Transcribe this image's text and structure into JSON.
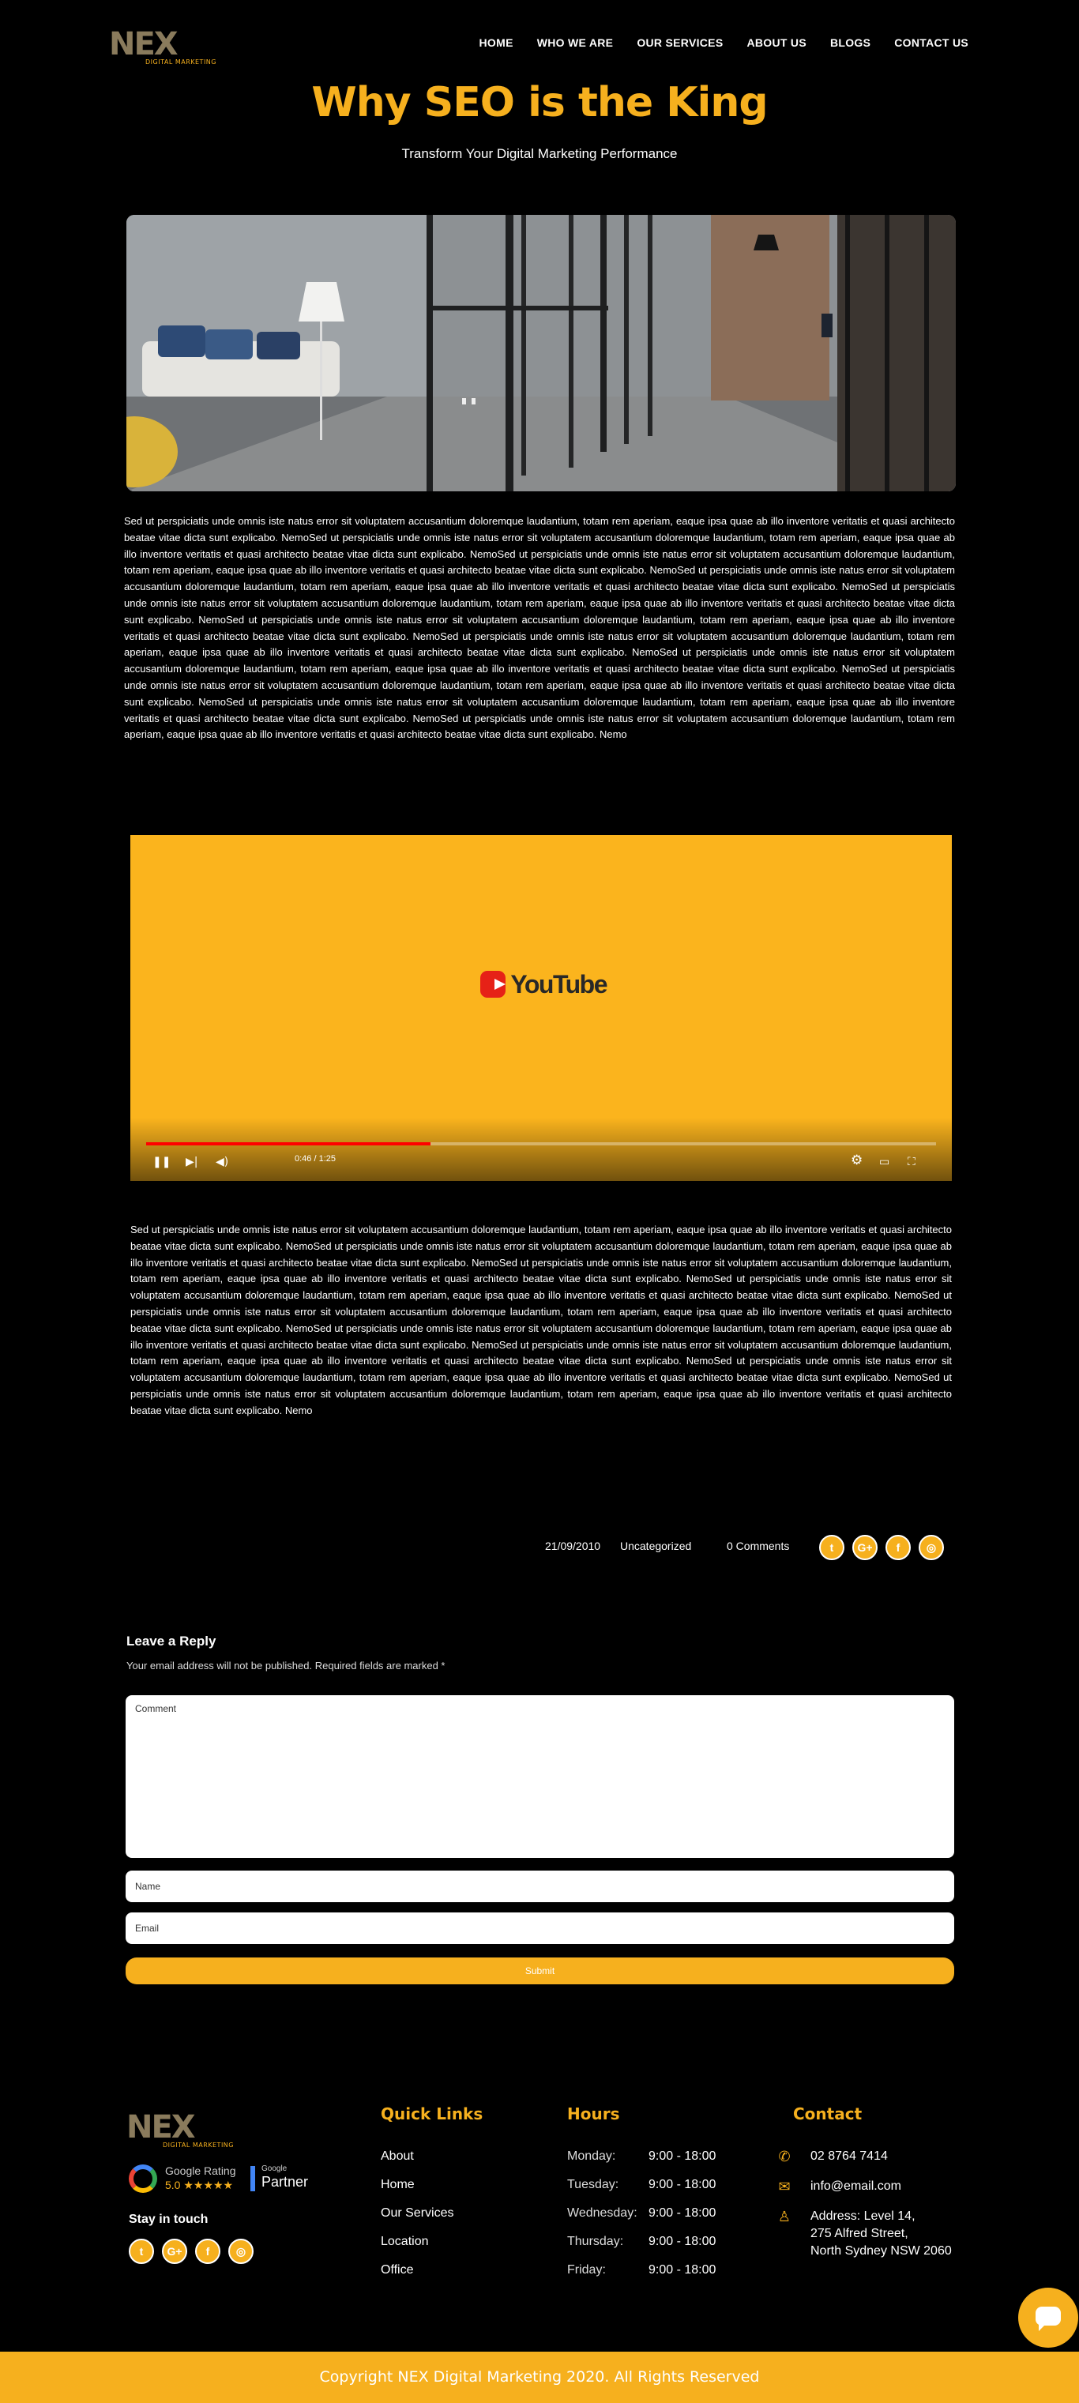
{
  "header": {
    "logo_text": "NEX",
    "logo_tagline": "DIGITAL MARKETING",
    "nav": [
      "HOME",
      "WHO WE ARE",
      "OUR SERVICES",
      "ABOUT US",
      "BLOGS",
      "CONTACT US"
    ]
  },
  "article": {
    "title": "Why SEO is the King",
    "subtitle": "Transform Your Digital Marketing Performance",
    "paragraph_1": "Sed ut perspiciatis unde omnis iste natus error sit voluptatem accusantium doloremque laudantium, totam rem aperiam, eaque ipsa quae ab illo inventore veritatis et quasi architecto beatae vitae dicta sunt explicabo. NemoSed ut perspiciatis unde omnis iste natus error sit voluptatem accusantium doloremque laudantium, totam rem aperiam, eaque ipsa quae ab illo inventore veritatis et quasi architecto beatae vitae dicta sunt explicabo. NemoSed ut perspiciatis unde omnis iste natus error sit voluptatem accusantium doloremque laudantium, totam rem aperiam, eaque ipsa quae ab illo inventore veritatis et quasi architecto beatae vitae dicta sunt explicabo. NemoSed ut perspiciatis unde omnis iste natus error sit voluptatem accusantium doloremque laudantium, totam rem aperiam, eaque ipsa quae ab illo inventore veritatis et quasi architecto beatae vitae dicta sunt explicabo. NemoSed ut perspiciatis unde omnis iste natus error sit voluptatem accusantium doloremque laudantium, totam rem aperiam, eaque ipsa quae ab illo inventore veritatis et quasi architecto beatae vitae dicta sunt explicabo. NemoSed ut perspiciatis unde omnis iste natus error sit voluptatem accusantium doloremque laudantium, totam rem aperiam, eaque ipsa quae ab illo inventore veritatis et quasi architecto beatae vitae dicta sunt explicabo. NemoSed ut perspiciatis unde omnis iste natus error sit voluptatem accusantium doloremque laudantium, totam rem aperiam, eaque ipsa quae ab illo inventore veritatis et quasi architecto beatae vitae dicta sunt explicabo. NemoSed ut perspiciatis unde omnis iste natus error sit voluptatem accusantium doloremque laudantium, totam rem aperiam, eaque ipsa quae ab illo inventore veritatis et quasi architecto beatae vitae dicta sunt explicabo. NemoSed ut perspiciatis unde omnis iste natus error sit voluptatem accusantium doloremque laudantium, totam rem aperiam, eaque ipsa quae ab illo inventore veritatis et quasi architecto beatae vitae dicta sunt explicabo. NemoSed ut perspiciatis unde omnis iste natus error sit voluptatem accusantium doloremque laudantium, totam rem aperiam, eaque ipsa quae ab illo inventore veritatis et quasi architecto beatae vitae dicta sunt explicabo. NemoSed ut perspiciatis unde omnis iste natus error sit voluptatem accusantium doloremque laudantium, totam rem aperiam, eaque ipsa quae ab illo inventore veritatis et quasi architecto beatae vitae dicta sunt explicabo. Nemo",
    "paragraph_2": "Sed ut perspiciatis unde omnis iste natus error sit voluptatem accusantium doloremque laudantium, totam rem aperiam, eaque ipsa quae ab illo inventore veritatis et quasi architecto beatae vitae dicta sunt explicabo. NemoSed ut perspiciatis unde omnis iste natus error sit voluptatem accusantium doloremque laudantium, totam rem aperiam, eaque ipsa quae ab illo inventore veritatis et quasi architecto beatae vitae dicta sunt explicabo. NemoSed ut perspiciatis unde omnis iste natus error sit voluptatem accusantium doloremque laudantium, totam rem aperiam, eaque ipsa quae ab illo inventore veritatis et quasi architecto beatae vitae dicta sunt explicabo. NemoSed ut perspiciatis unde omnis iste natus error sit voluptatem accusantium doloremque laudantium, totam rem aperiam, eaque ipsa quae ab illo inventore veritatis et quasi architecto beatae vitae dicta sunt explicabo. NemoSed ut perspiciatis unde omnis iste natus error sit voluptatem accusantium doloremque laudantium, totam rem aperiam, eaque ipsa quae ab illo inventore veritatis et quasi architecto beatae vitae dicta sunt explicabo. NemoSed ut perspiciatis unde omnis iste natus error sit voluptatem accusantium doloremque laudantium, totam rem aperiam, eaque ipsa quae ab illo inventore veritatis et quasi architecto beatae vitae dicta sunt explicabo. NemoSed ut perspiciatis unde omnis iste natus error sit voluptatem accusantium doloremque laudantium, totam rem aperiam, eaque ipsa quae ab illo inventore veritatis et quasi architecto beatae vitae dicta sunt explicabo. NemoSed ut perspiciatis unde omnis iste natus error sit voluptatem accusantium doloremque laudantium, totam rem aperiam, eaque ipsa quae ab illo inventore veritatis et quasi architecto beatae vitae dicta sunt explicabo. NemoSed ut perspiciatis unde omnis iste natus error sit voluptatem accusantium doloremque laudantium, totam rem aperiam, eaque ipsa quae ab illo inventore veritatis et quasi architecto beatae vitae dicta sunt explicabo. Nemo"
  },
  "video": {
    "brand": "YouTube",
    "time": "0:46 / 1:25",
    "progress_fraction": 0.36
  },
  "meta": {
    "date": "21/09/2010",
    "category": "Uncategorized",
    "comments": "0 Comments"
  },
  "social_icons": [
    "twitter-icon",
    "google-plus-icon",
    "facebook-icon",
    "instagram-icon"
  ],
  "social_glyphs": [
    "t",
    "G+",
    "f",
    "◎"
  ],
  "reply": {
    "title": "Leave a Reply",
    "note": "Your email address will not be published. Required fields are marked *",
    "comment_placeholder": "Comment",
    "name_placeholder": "Name",
    "email_placeholder": "Email",
    "submit_label": "Submit"
  },
  "footer": {
    "rating_label": "Google Rating",
    "rating_score": "5.0 ★★★★★",
    "partner_small": "Google",
    "partner_big": "Partner",
    "stay_in_touch": "Stay in touch",
    "links_heading": "Quick Links",
    "links": [
      "About",
      "Home",
      "Our Services",
      "Location",
      "Office"
    ],
    "hours_heading": "Hours",
    "hours": [
      {
        "day": "Monday:",
        "time": "9:00 - 18:00"
      },
      {
        "day": "Tuesday:",
        "time": "9:00 - 18:00"
      },
      {
        "day": "Wednesday:",
        "time": "9:00 - 18:00"
      },
      {
        "day": "Thursday:",
        "time": "9:00 - 18:00"
      },
      {
        "day": "Friday:",
        "time": "9:00 - 18:00"
      }
    ],
    "contact_heading": "Contact",
    "phone": "02 8764 7414",
    "email": "info@email.com",
    "address_line_1": "Address: Level 14,",
    "address_line_2": "275 Alfred Street,",
    "address_line_3": "North Sydney NSW 2060",
    "copyright": "Copyright NEX Digital Marketing 2020. All Rights Reserved"
  },
  "colors": {
    "accent": "#f6b01e",
    "background": "#000000",
    "video_background": "#fbb41d"
  }
}
